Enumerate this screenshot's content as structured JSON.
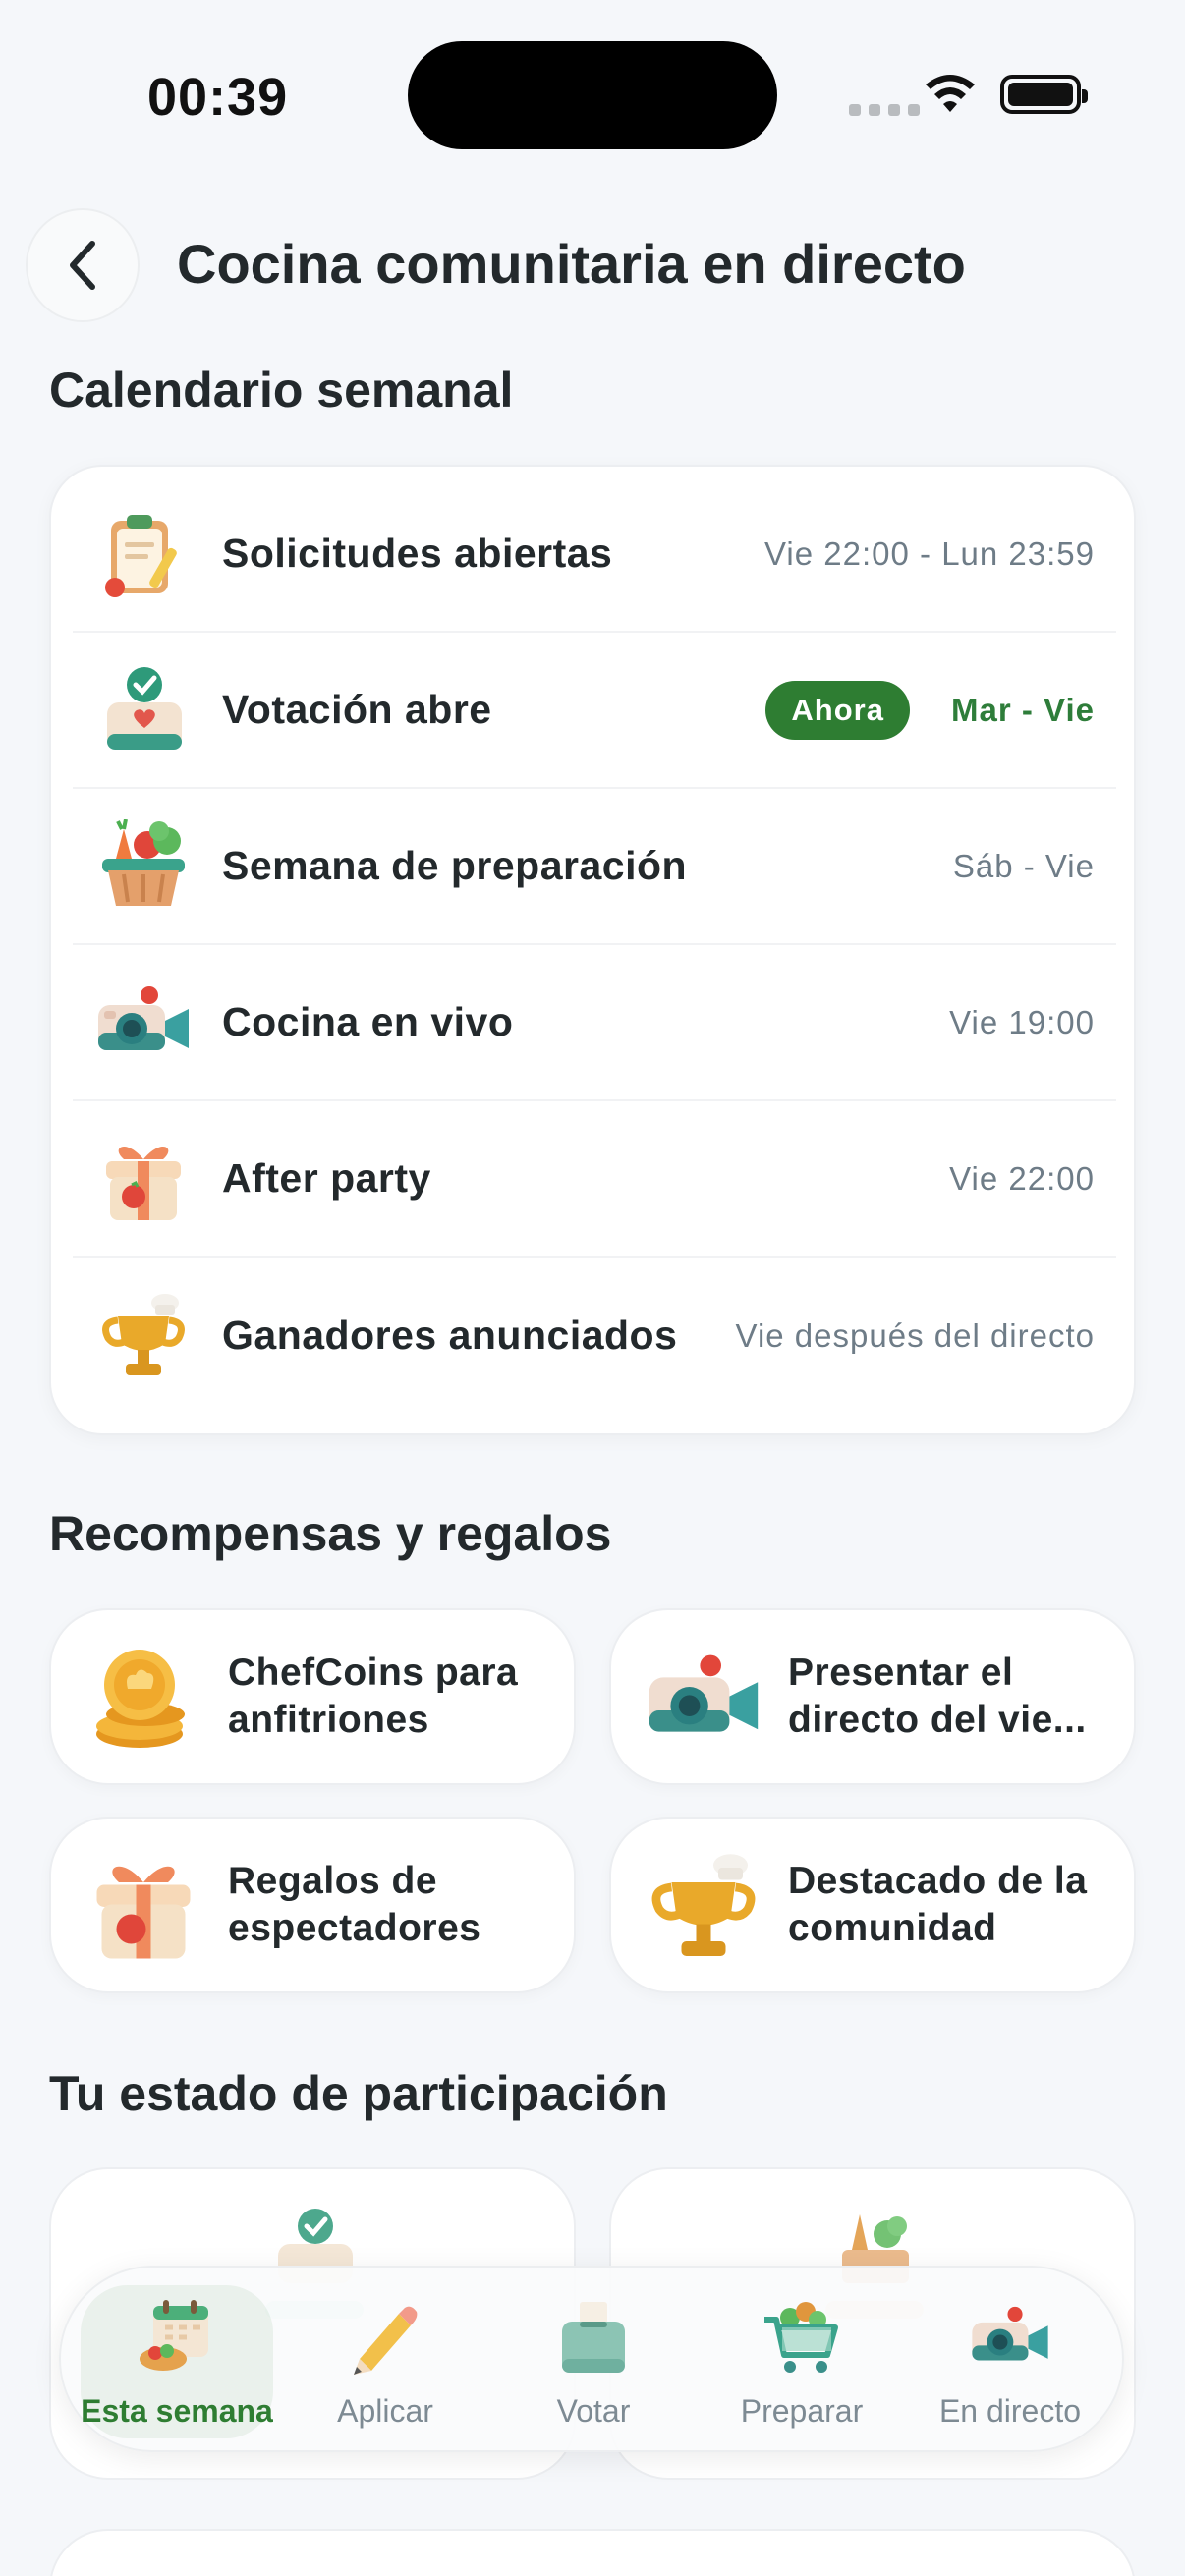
{
  "status_bar": {
    "time": "00:39"
  },
  "header": {
    "title": "Cocina comunitaria en directo"
  },
  "calendar": {
    "section_title": "Calendario semanal",
    "rows": [
      {
        "label": "Solicitudes abiertas",
        "date": "Vie 22:00 - Lun 23:59",
        "icon": "clipboard-icon"
      },
      {
        "label": "Votación abre",
        "date": "Mar - Vie",
        "badge": "Ahora",
        "icon": "ballot-box-icon",
        "highlight_color": "#2e7d32"
      },
      {
        "label": "Semana de preparación",
        "date": "Sáb - Vie",
        "icon": "vegetable-basket-icon"
      },
      {
        "label": "Cocina en vivo",
        "date": "Vie 19:00",
        "icon": "camera-icon"
      },
      {
        "label": "After party",
        "date": "Vie 22:00",
        "icon": "gift-icon"
      },
      {
        "label": "Ganadores anunciados",
        "date": "Vie después del directo",
        "icon": "trophy-icon"
      }
    ]
  },
  "rewards": {
    "section_title": "Recompensas y regalos",
    "items": [
      {
        "label": "ChefCoins para anfitriones",
        "icon": "coins-icon"
      },
      {
        "label": "Presentar el directo del vie...",
        "icon": "camera-icon"
      },
      {
        "label": "Regalos de espectadores",
        "icon": "gift-icon"
      },
      {
        "label": "Destacado de la comunidad",
        "icon": "trophy-icon"
      }
    ]
  },
  "participation": {
    "section_title": "Tu estado de participación"
  },
  "tab_bar": {
    "tabs": [
      {
        "label": "Esta semana",
        "icon": "calendar-icon",
        "active": true
      },
      {
        "label": "Aplicar",
        "icon": "pencil-icon",
        "active": false
      },
      {
        "label": "Votar",
        "icon": "ballot-box-icon",
        "active": false
      },
      {
        "label": "Preparar",
        "icon": "cart-icon",
        "active": false
      },
      {
        "label": "En directo",
        "icon": "camera-icon",
        "active": false
      }
    ]
  },
  "colors": {
    "accent": "#2e7d32",
    "background": "#f5f7fa",
    "muted_text": "#6e7c87"
  }
}
